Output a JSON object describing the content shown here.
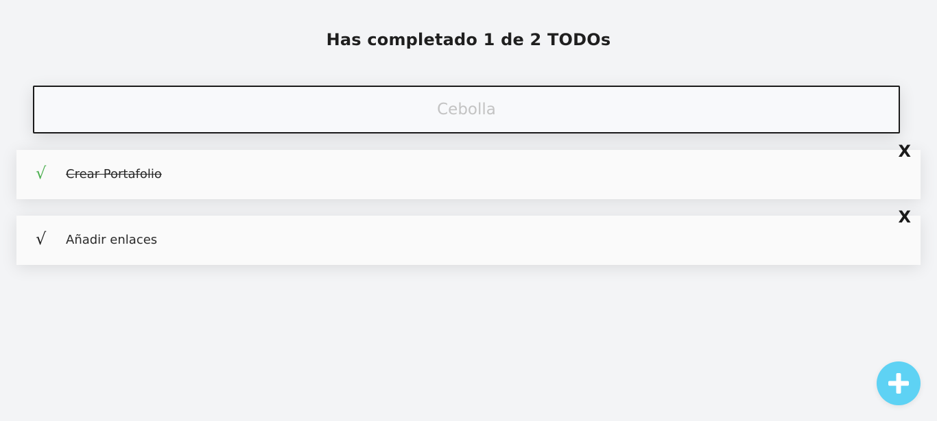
{
  "header": {
    "title": "Has completado 1 de 2 TODOs"
  },
  "input": {
    "placeholder": "Cebolla",
    "value": ""
  },
  "todos": [
    {
      "text": "Crear Portafolio",
      "completed": true,
      "check_glyph": "√",
      "delete_label": "X"
    },
    {
      "text": "Añadir enlaces",
      "completed": false,
      "check_glyph": "√",
      "delete_label": "X"
    }
  ],
  "icons": {
    "check": "check-icon",
    "add": "plus-icon"
  },
  "colors": {
    "background": "#f3f4f6",
    "completed_check": "#4caf50",
    "pending_check": "#1f1f1f",
    "add_button": "#5ed2f4",
    "add_icon": "#ffffff"
  }
}
